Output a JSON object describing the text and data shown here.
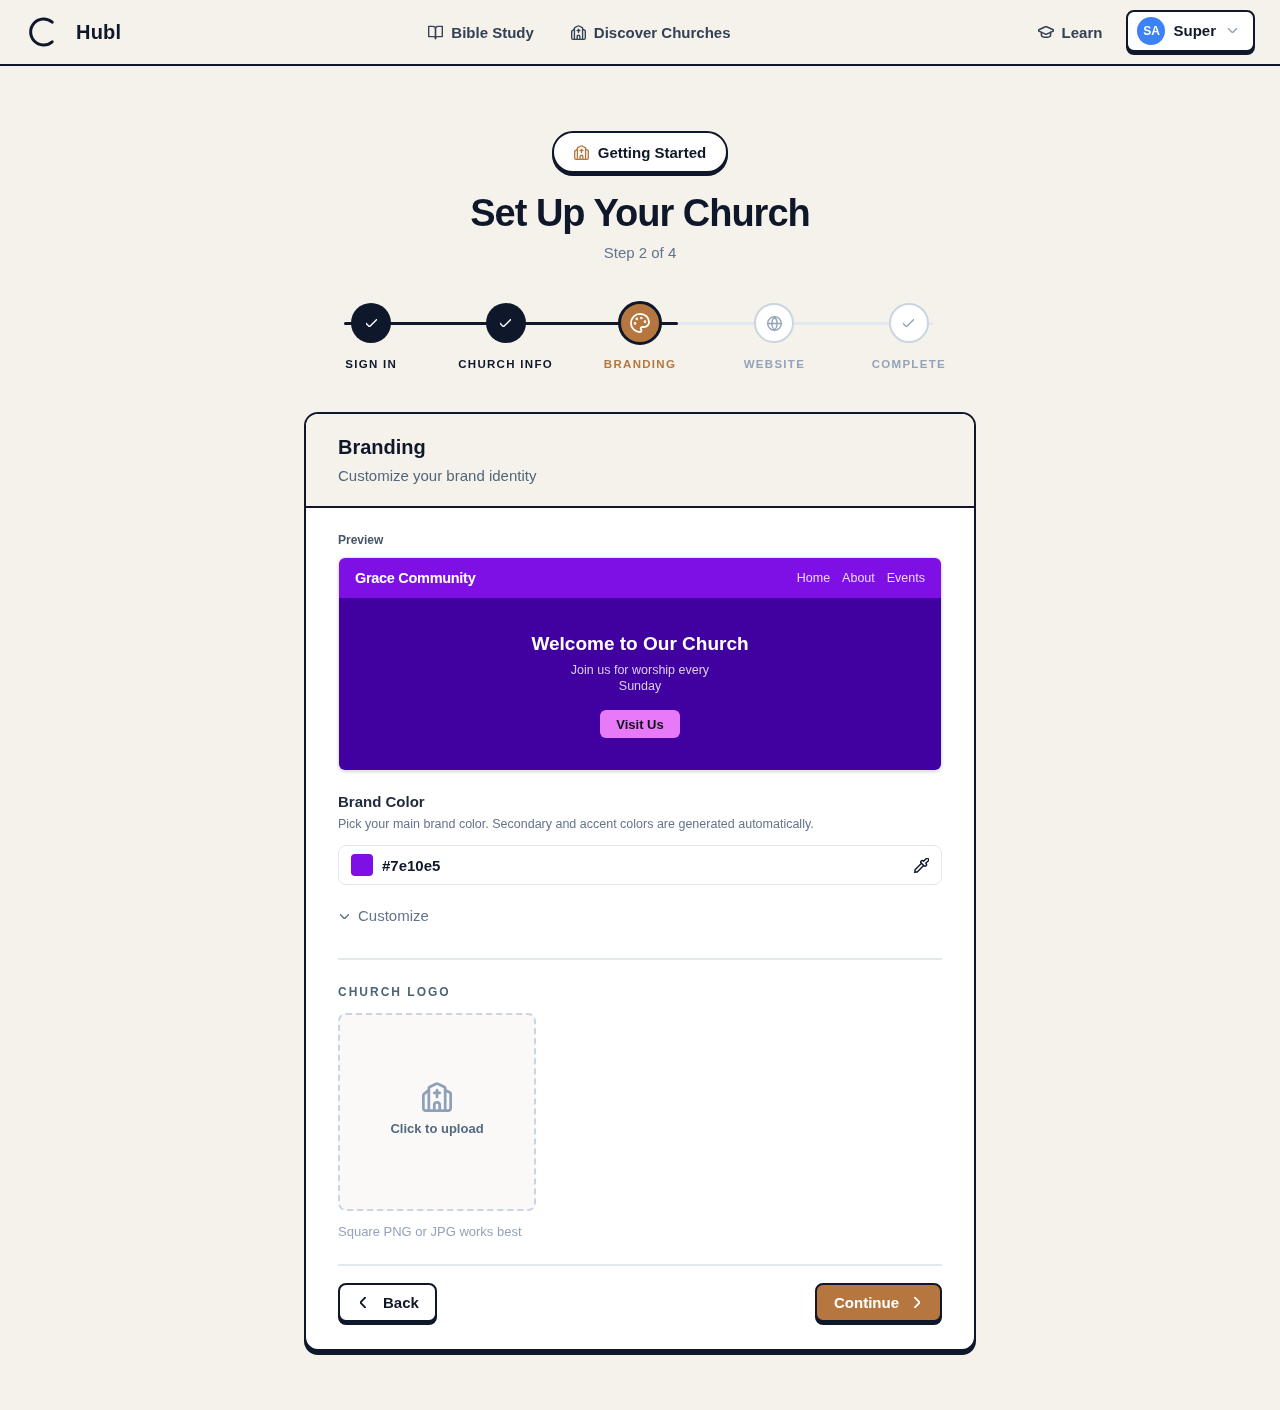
{
  "header": {
    "logo_text": "Hubl",
    "nav": [
      {
        "label": "Bible Study",
        "kind": "book"
      },
      {
        "label": "Discover Churches",
        "kind": "church"
      }
    ],
    "learn": {
      "label": "Learn"
    },
    "user": {
      "initials": "SA",
      "name": "Super"
    }
  },
  "badge": {
    "label": "Getting Started"
  },
  "title": "Set Up Your Church",
  "step_caption": "Step 2 of 4",
  "steps": [
    {
      "label": "SIGN IN",
      "completed": true,
      "selected": false,
      "kind": "check"
    },
    {
      "label": "CHURCH INFO",
      "completed": true,
      "selected": false,
      "kind": "check"
    },
    {
      "label": "BRANDING",
      "completed": false,
      "selected": true,
      "kind": "palette"
    },
    {
      "label": "WEBSITE",
      "completed": false,
      "selected": false,
      "kind": "globe"
    },
    {
      "label": "COMPLETE",
      "completed": false,
      "selected": false,
      "kind": "check"
    }
  ],
  "card": {
    "title": "Branding",
    "subtitle": "Customize your brand identity",
    "preview": {
      "label": "Preview",
      "site_name": "Grace Community",
      "nav_links": [
        "Home",
        "About",
        "Events"
      ],
      "hero_title": "Welcome to Our Church",
      "hero_text": "Join us for worship every Sunday",
      "cta": "Visit Us"
    },
    "brand_color": {
      "label": "Brand Color",
      "help": "Pick your main brand color. Secondary and accent colors are generated automatically.",
      "value": "#7e10e5",
      "color": "#7e10e5"
    },
    "customize": {
      "label": "Customize",
      "expanded": false
    },
    "logo": {
      "heading": "CHURCH LOGO",
      "upload_label": "Click to upload",
      "hint": "Square PNG or JPG works best"
    },
    "actions": {
      "back": "Back",
      "continue": "Continue"
    }
  }
}
